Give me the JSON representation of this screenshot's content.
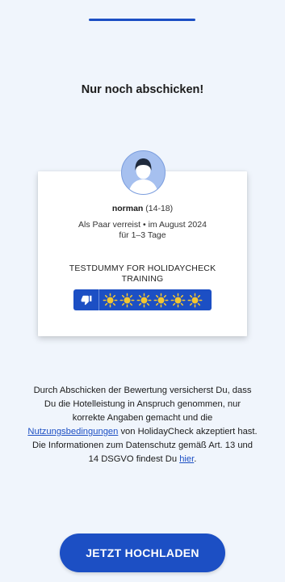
{
  "header": {
    "title": "Nur noch abschicken!"
  },
  "review_card": {
    "reviewer_name": "norman",
    "reviewer_age": "(14-18)",
    "trip_line1": "Als Paar verreist • im August 2024",
    "trip_line2": "für 1–3 Tage",
    "hotel_name_line1": "TESTDUMMY FOR HOLIDAYCHECK",
    "hotel_name_line2": "TRAINING",
    "rating": {
      "recommendation_icon": "thumbs-down-icon",
      "suns_total": 6,
      "sun_icon": "sun-icon"
    }
  },
  "disclaimer": {
    "part1": "Durch Abschicken der Bewertung versicherst Du, dass Du die Hotelleistung in Anspruch genommen, nur korrekte Angaben gemacht und die ",
    "terms_link": "Nutzungsbedingungen",
    "part2": " von HolidayCheck akzeptiert hast. Die Informationen zum Datenschutz gemäß Art. 13 und 14 DSGVO findest Du ",
    "privacy_link": "hier",
    "part3": "."
  },
  "actions": {
    "upload_label": "JETZT HOCHLADEN"
  },
  "colors": {
    "accent": "#1c4fc4",
    "background": "#f0f5fc",
    "sun": "#f3c630"
  }
}
